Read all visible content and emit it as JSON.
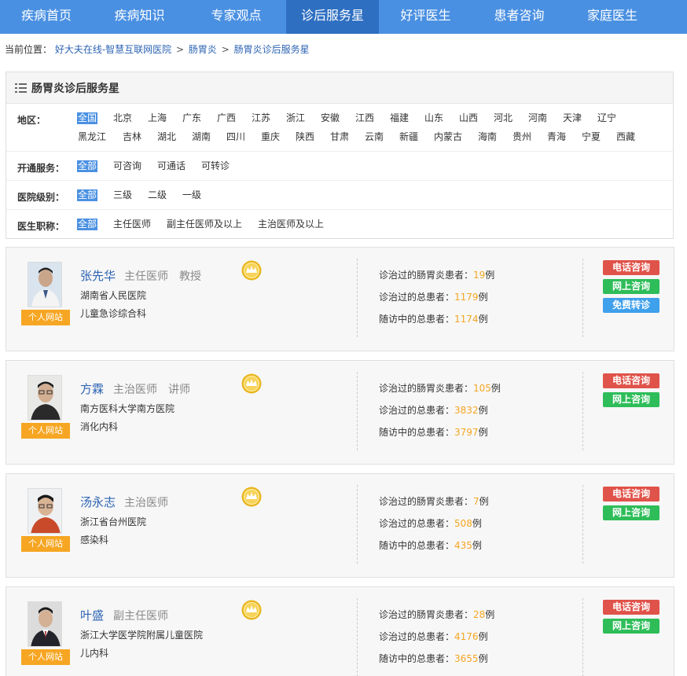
{
  "nav": {
    "items": [
      {
        "label": "疾病首页"
      },
      {
        "label": "疾病知识"
      },
      {
        "label": "专家观点"
      },
      {
        "label": "诊后服务星"
      },
      {
        "label": "好评医生"
      },
      {
        "label": "患者咨询"
      },
      {
        "label": "家庭医生"
      }
    ],
    "active_index": 3
  },
  "breadcrumb": {
    "prefix": "当前位置：",
    "links": [
      "好大夫在线-智慧互联网医院",
      "肠胃炎",
      "肠胃炎诊后服务星"
    ],
    "separator": ">"
  },
  "filter": {
    "title": "肠胃炎诊后服务星",
    "region": {
      "label": "地区：",
      "options": [
        "全国",
        "北京",
        "上海",
        "广东",
        "广西",
        "江苏",
        "浙江",
        "安徽",
        "江西",
        "福建",
        "山东",
        "山西",
        "河北",
        "河南",
        "天津",
        "辽宁",
        "黑龙江",
        "吉林",
        "湖北",
        "湖南",
        "四川",
        "重庆",
        "陕西",
        "甘肃",
        "云南",
        "新疆",
        "内蒙古",
        "海南",
        "贵州",
        "青海",
        "宁夏",
        "西藏"
      ],
      "selected": "全国"
    },
    "service": {
      "label": "开通服务：",
      "options": [
        "全部",
        "可咨询",
        "可通话",
        "可转诊"
      ],
      "selected": "全部"
    },
    "level": {
      "label": "医院级别：",
      "options": [
        "全部",
        "三级",
        "二级",
        "一级"
      ],
      "selected": "全部"
    },
    "title_filter": {
      "label": "医生职称：",
      "options": [
        "全部",
        "主任医师",
        "副主任医师及以上",
        "主治医师及以上"
      ],
      "selected": "全部"
    }
  },
  "colors": {
    "nav_bg": "#4a90e2",
    "nav_active": "#2e6fc2",
    "link": "#2d64b3",
    "number": "#f5a623",
    "site_button": "#f6a623",
    "phone_button": "#e0534a",
    "online_button": "#2ebd59",
    "referral_button": "#3fa0ec"
  },
  "doctors": [
    {
      "name": "张先华",
      "title": "主任医师",
      "academic": "教授",
      "hospital": "湖南省人民医院",
      "department": "儿童急诊综合科",
      "site_label": "个人网站",
      "stats": [
        {
          "label": "诊治过的肠胃炎患者：",
          "value": "19",
          "unit": "例"
        },
        {
          "label": "诊治过的总患者：",
          "value": "1179",
          "unit": "例"
        },
        {
          "label": "随访中的总患者：",
          "value": "1174",
          "unit": "例"
        }
      ],
      "actions": [
        "电话咨询",
        "网上咨询",
        "免费转诊"
      ]
    },
    {
      "name": "方霖",
      "title": "主治医师",
      "academic": "讲师",
      "hospital": "南方医科大学南方医院",
      "department": "消化内科",
      "site_label": "个人网站",
      "stats": [
        {
          "label": "诊治过的肠胃炎患者：",
          "value": "105",
          "unit": "例"
        },
        {
          "label": "诊治过的总患者：",
          "value": "3832",
          "unit": "例"
        },
        {
          "label": "随访中的总患者：",
          "value": "3797",
          "unit": "例"
        }
      ],
      "actions": [
        "电话咨询",
        "网上咨询"
      ]
    },
    {
      "name": "汤永志",
      "title": "主治医师",
      "academic": "",
      "hospital": "浙江省台州医院",
      "department": "感染科",
      "site_label": "个人网站",
      "stats": [
        {
          "label": "诊治过的肠胃炎患者：",
          "value": "7",
          "unit": "例"
        },
        {
          "label": "诊治过的总患者：",
          "value": "508",
          "unit": "例"
        },
        {
          "label": "随访中的总患者：",
          "value": "435",
          "unit": "例"
        }
      ],
      "actions": [
        "电话咨询",
        "网上咨询"
      ]
    },
    {
      "name": "叶盛",
      "title": "副主任医师",
      "academic": "",
      "hospital": "浙江大学医学院附属儿童医院",
      "department": "儿内科",
      "site_label": "个人网站",
      "stats": [
        {
          "label": "诊治过的肠胃炎患者：",
          "value": "28",
          "unit": "例"
        },
        {
          "label": "诊治过的总患者：",
          "value": "4176",
          "unit": "例"
        },
        {
          "label": "随访中的总患者：",
          "value": "3655",
          "unit": "例"
        }
      ],
      "actions": [
        "电话咨询",
        "网上咨询"
      ]
    }
  ]
}
